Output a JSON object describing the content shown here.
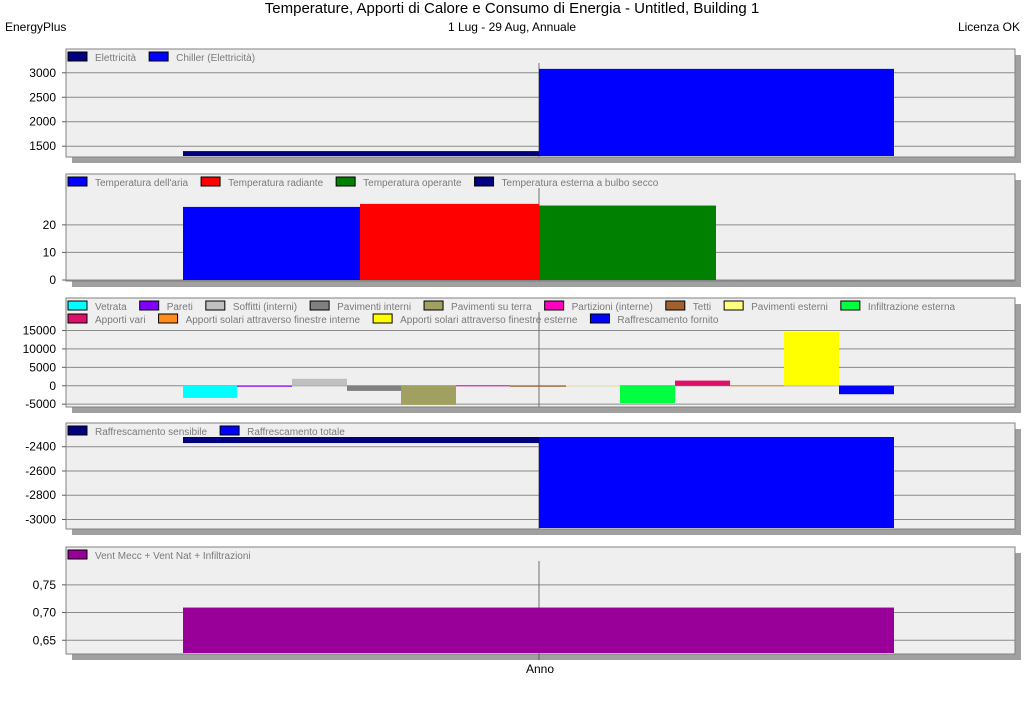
{
  "header": {
    "title": "Temperature, Apporti di Calore e Consumo di Energia - Untitled, Building 1",
    "subtitle": "1 Lug - 29 Aug, Annuale",
    "left_label": "EnergyPlus",
    "right_label": "Licenza OK"
  },
  "x_category": "Anno",
  "chart_data": [
    {
      "type": "bar",
      "categories": [
        "Anno"
      ],
      "ylim": [
        1300,
        3200
      ],
      "yticks": [
        1500,
        2000,
        2500,
        3000
      ],
      "ytick_labels": [
        "1500",
        "2000",
        "2500",
        "3000"
      ],
      "series": [
        {
          "name": "Elettricità",
          "color": "#000080",
          "values": [
            1400
          ]
        },
        {
          "name": "Chiller (Elettricità)",
          "color": "#0000FF",
          "values": [
            3080
          ]
        }
      ]
    },
    {
      "type": "bar",
      "categories": [
        "Anno"
      ],
      "ylim": [
        0,
        33
      ],
      "yticks": [
        0,
        10,
        20
      ],
      "ytick_labels": [
        "0",
        "10",
        "20"
      ],
      "series": [
        {
          "name": "Temperatura dell'aria",
          "color": "#0000FF",
          "values": [
            26.5
          ]
        },
        {
          "name": "Temperatura radiante",
          "color": "#FF0000",
          "values": [
            27.6
          ]
        },
        {
          "name": "Temperatura operante",
          "color": "#008000",
          "values": [
            27.0
          ]
        },
        {
          "name": "Temperatura esterna a bulbo secco",
          "color": "#000080",
          "values": [
            0
          ]
        }
      ]
    },
    {
      "type": "bar",
      "categories": [
        "Anno"
      ],
      "ylim": [
        -5500,
        16500
      ],
      "yticks": [
        -5000,
        0,
        5000,
        10000,
        15000
      ],
      "ytick_labels": [
        "-5000",
        "0",
        "5000",
        "10000",
        "15000"
      ],
      "series": [
        {
          "name": "Vetrata",
          "color": "#00FFFF",
          "values": [
            -3300
          ]
        },
        {
          "name": "Pareti",
          "color": "#8000FF",
          "values": [
            -200
          ]
        },
        {
          "name": "Soffitti (interni)",
          "color": "#C0C0C0",
          "values": [
            1900
          ]
        },
        {
          "name": "Pavimenti interni",
          "color": "#808080",
          "values": [
            -1400
          ]
        },
        {
          "name": "Pavimenti su terra",
          "color": "#A0A060",
          "values": [
            -5200
          ]
        },
        {
          "name": "Partizioni (interne)",
          "color": "#FF00C0",
          "values": [
            0
          ]
        },
        {
          "name": "Tetti",
          "color": "#A06030",
          "values": [
            -150
          ]
        },
        {
          "name": "Pavimenti esterni",
          "color": "#FFFF80",
          "values": [
            0
          ]
        },
        {
          "name": "Infiltrazione esterna",
          "color": "#00FF40",
          "values": [
            -4700
          ]
        },
        {
          "name": "Apporti vari",
          "color": "#E0106A",
          "values": [
            1400
          ]
        },
        {
          "name": "Apporti solari attraverso finestre interne",
          "color": "#FF8C1A",
          "values": [
            0
          ]
        },
        {
          "name": "Apporti solari attraverso finestre esterne",
          "color": "#FFFF00",
          "values": [
            14600
          ]
        },
        {
          "name": "Raffrescamento fornito",
          "color": "#0000FF",
          "values": [
            -2300
          ]
        }
      ]
    },
    {
      "type": "bar",
      "categories": [
        "Anno"
      ],
      "ylim": [
        -3070,
        -2320
      ],
      "yticks": [
        -3000,
        -2800,
        -2600,
        -2400
      ],
      "ytick_labels": [
        "-3000",
        "-2800",
        "-2600",
        "-2400"
      ],
      "series": [
        {
          "name": "Raffrescamento sensibile",
          "color": "#000080",
          "values": [
            -2370
          ]
        },
        {
          "name": "Raffrescamento totale",
          "color": "#0000FF",
          "values": [
            -3080
          ]
        }
      ]
    },
    {
      "type": "bar",
      "categories": [
        "Anno"
      ],
      "ylim": [
        0.627,
        0.793
      ],
      "yticks": [
        0.65,
        0.7,
        0.75
      ],
      "ytick_labels": [
        "0,65",
        "0,70",
        "0,75"
      ],
      "series": [
        {
          "name": "Vent Mecc + Vent Nat + Infiltrazioni",
          "color": "#990099",
          "values": [
            0.709
          ]
        }
      ]
    }
  ]
}
